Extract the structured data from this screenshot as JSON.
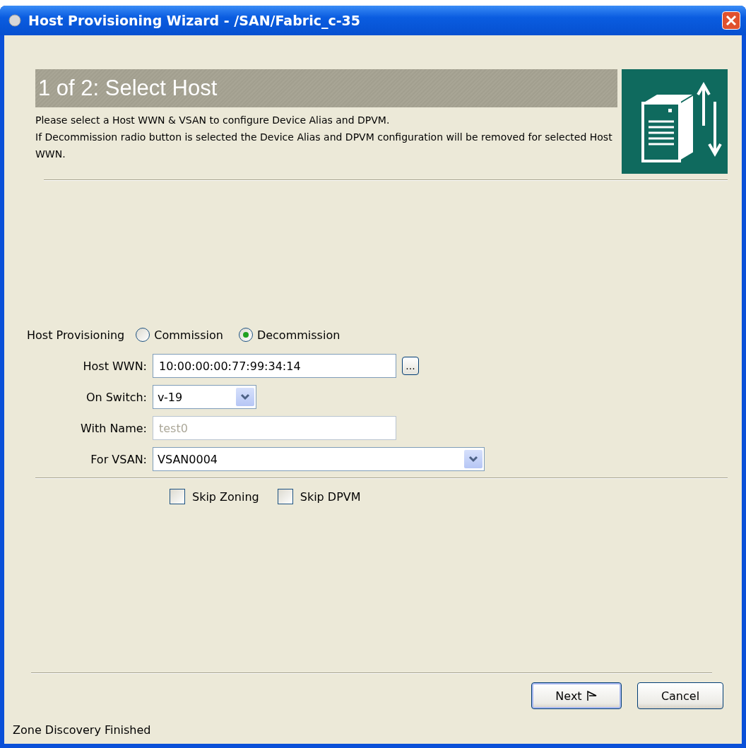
{
  "window": {
    "title": "Host Provisioning Wizard - /SAN/Fabric_c-35"
  },
  "header": {
    "step_title": "1 of 2: Select Host",
    "description": [
      "Please select a Host WWN & VSAN to configure Device Alias and DPVM.",
      "If Decommission radio button is selected the Device Alias and DPVM configuration will be removed for selected Host WWN."
    ]
  },
  "provisioning": {
    "label": "Host Provisioning",
    "options": [
      {
        "label": "Commission",
        "selected": false
      },
      {
        "label": "Decommission",
        "selected": true
      }
    ]
  },
  "fields": [
    {
      "kind": "text",
      "label": "Host WWN:",
      "value": "10:00:00:00:77:99:34:14",
      "disabled": false,
      "browse_button": "..."
    },
    {
      "kind": "combo",
      "label": "On Switch:",
      "value": "v-19",
      "disabled": false
    },
    {
      "kind": "text",
      "label": "With Name:",
      "value": "test0",
      "disabled": true
    },
    {
      "kind": "combo",
      "label": "For VSAN:",
      "value": "VSAN0004",
      "disabled": false
    }
  ],
  "options": [
    {
      "label": "Skip Zoning",
      "checked": false
    },
    {
      "label": "Skip DPVM",
      "checked": false
    }
  ],
  "buttons": [
    {
      "label": "Next",
      "kind": "next"
    },
    {
      "label": "Cancel",
      "kind": "plain"
    }
  ],
  "status_bar": "Zone Discovery Finished"
}
